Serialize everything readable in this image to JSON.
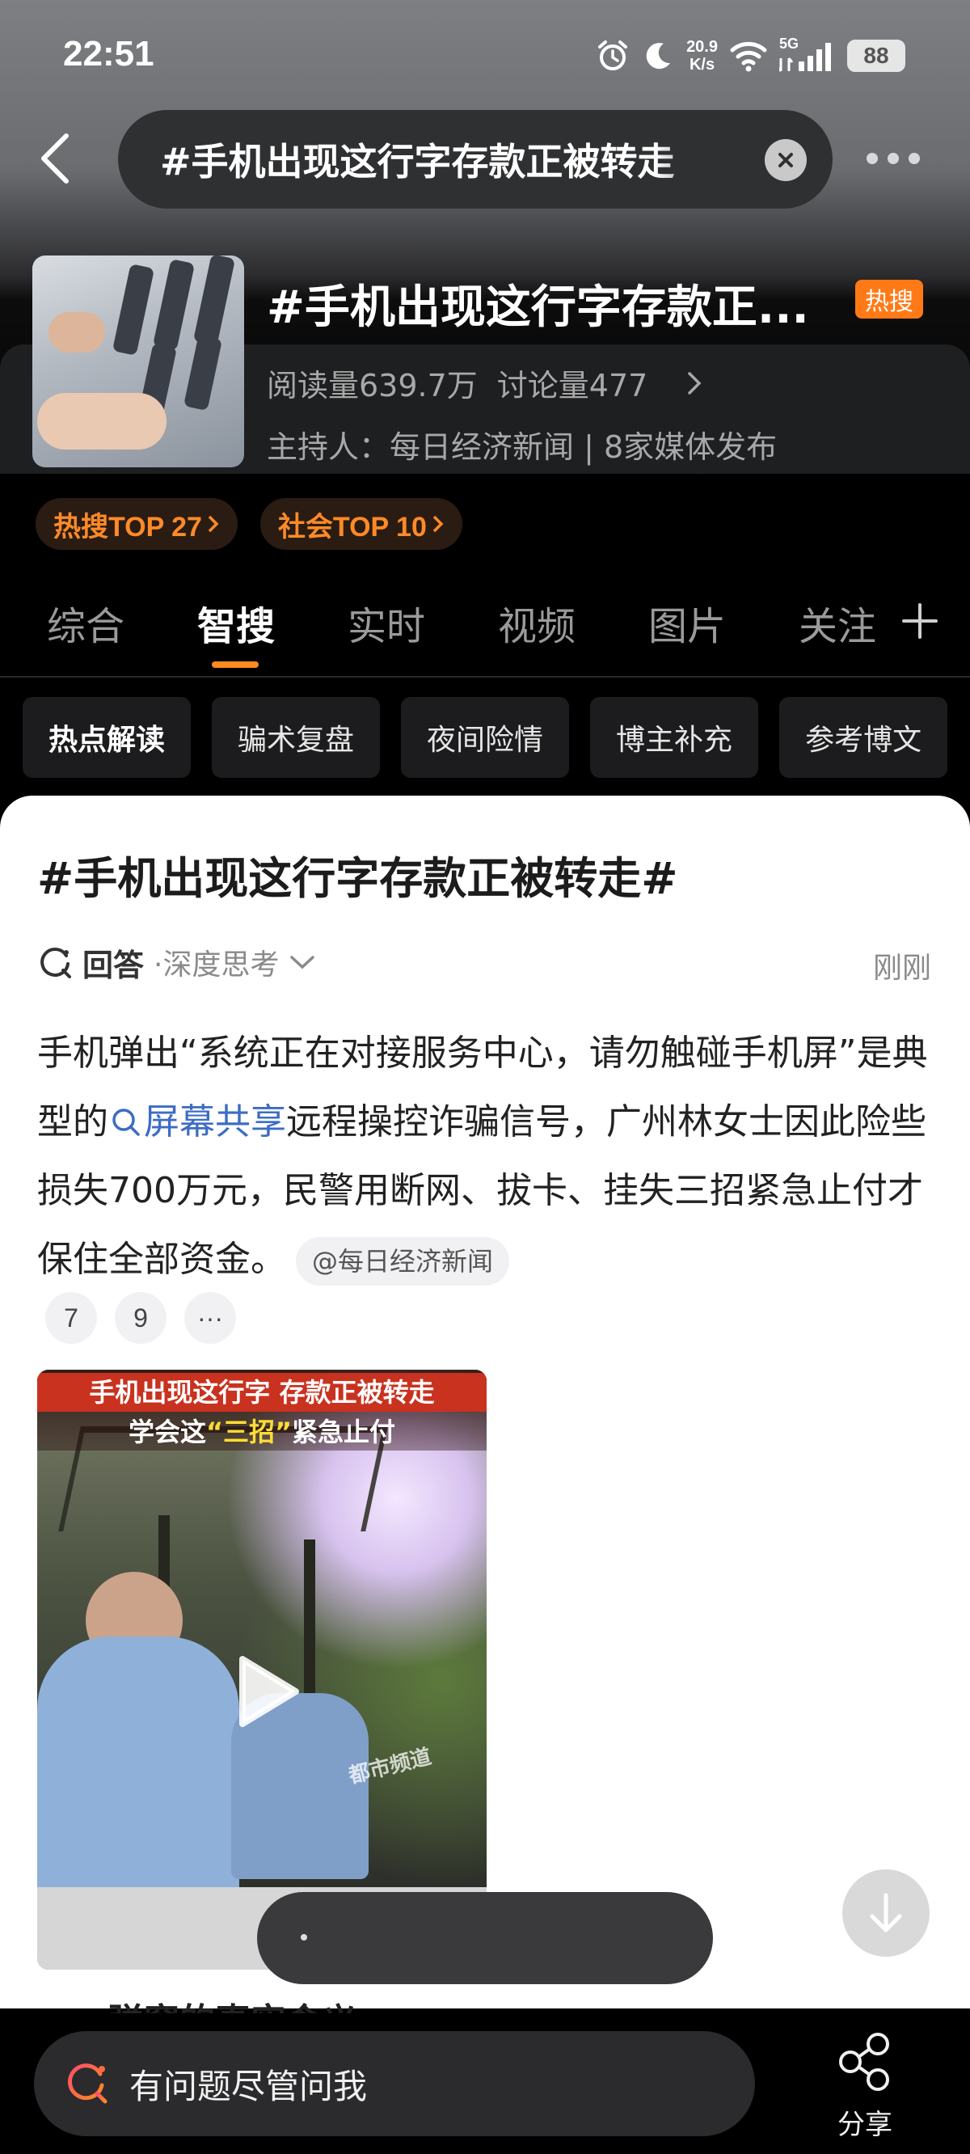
{
  "status_bar": {
    "time": "22:51",
    "net_speed_value": "20.9",
    "net_speed_unit": "K/s",
    "signal_label": "5G",
    "battery": "88"
  },
  "search": {
    "query": "#手机出现这行字存款正被转走"
  },
  "topic": {
    "title": "#手机出现这行字存款正...",
    "badge": "热搜",
    "reads": "阅读量639.7万",
    "discussions": "讨论量477",
    "host": "主持人：每日经济新闻 | 8家媒体发布"
  },
  "rank_pills": [
    {
      "label": "热搜TOP 27"
    },
    {
      "label": "社会TOP 10"
    }
  ],
  "tabs": [
    {
      "label": "综合"
    },
    {
      "label": "智搜"
    },
    {
      "label": "实时"
    },
    {
      "label": "视频"
    },
    {
      "label": "图片"
    },
    {
      "label": "关注"
    }
  ],
  "active_tab": "智搜",
  "chips": [
    {
      "label": "热点解读"
    },
    {
      "label": "骗术复盘"
    },
    {
      "label": "夜间险情"
    },
    {
      "label": "博主补充"
    },
    {
      "label": "参考博文"
    }
  ],
  "content": {
    "title": "#手机出现这行字存款正被转走#",
    "answer_label": "回答",
    "answer_mode": "·深度思考",
    "answer_time": "刚刚",
    "body_part1": "手机弹出“系统正在对接服务中心，请勿触碰手机屏”是典型的",
    "body_link": "屏幕共享",
    "body_part2": "远程操控诈骗信号，广州林女士因此险些损失700万元，民警用断网、拔卡、挂失三招紧急止付才保住全部资金。",
    "source_tag": "@每日经济新闻",
    "refs": [
      "7",
      "9",
      "···"
    ],
    "video_caption_line1": "手机出现这行字 存款正被转走",
    "video_caption_line2_a": "学会这",
    "video_caption_line2_b": "“三招”",
    "video_caption_line2_c": "紧急止付",
    "video_watermark": "都市频道",
    "next_heading": "一、弹窗的真实含义"
  },
  "bottom": {
    "ask_placeholder": "有问题尽管问我",
    "share_label": "分享"
  },
  "colors": {
    "accent_orange": "#ff8a1f",
    "hot_badge": "#ff7a17",
    "link_blue": "#3d6cc4",
    "video_caption_red": "#c8321f"
  }
}
